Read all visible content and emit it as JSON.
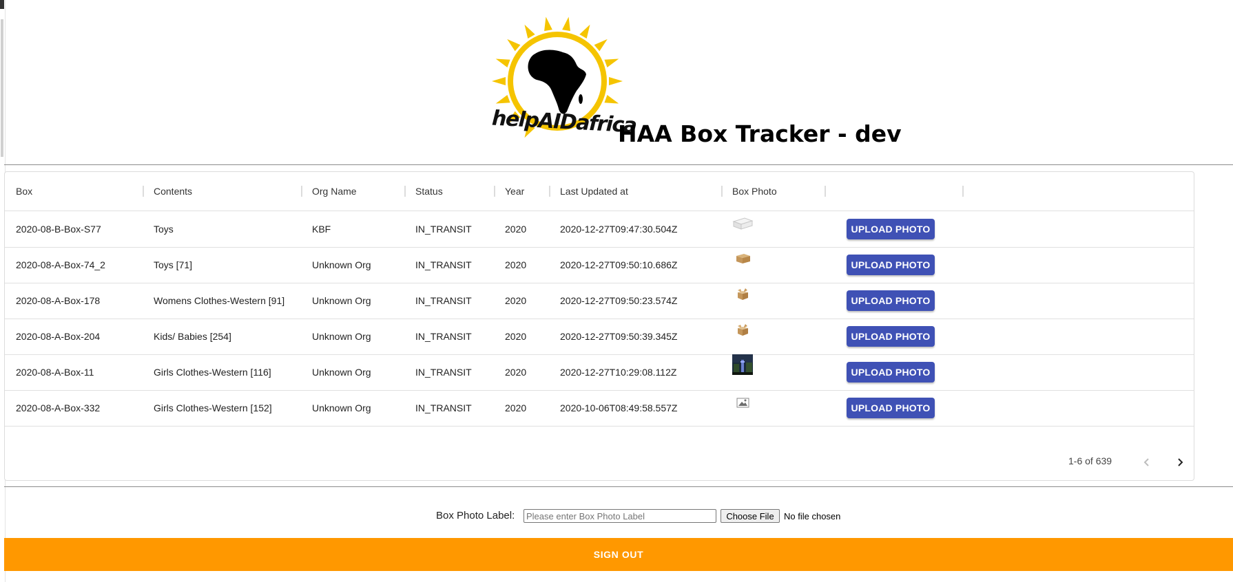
{
  "header": {
    "logo_text": "helpAIDafrica",
    "title": "HAA Box Tracker - dev"
  },
  "table": {
    "columns": [
      "Box",
      "Contents",
      "Org Name",
      "Status",
      "Year",
      "Last Updated at",
      "Box Photo",
      ""
    ],
    "rows": [
      {
        "box": "2020-08-B-Box-S77",
        "contents": "Toys",
        "org": "KBF",
        "status": "IN_TRANSIT",
        "year": "2020",
        "updated": "2020-12-27T09:47:30.504Z",
        "photo_icon": "white-box-photo",
        "action": "UPLOAD PHOTO"
      },
      {
        "box": "2020-08-A-Box-74_2",
        "contents": "Toys [71]",
        "org": "Unknown Org",
        "status": "IN_TRANSIT",
        "year": "2020",
        "updated": "2020-12-27T09:50:10.686Z",
        "photo_icon": "cardboard-box-photo",
        "action": "UPLOAD PHOTO"
      },
      {
        "box": "2020-08-A-Box-178",
        "contents": "Womens Clothes-Western [91]",
        "org": "Unknown Org",
        "status": "IN_TRANSIT",
        "year": "2020",
        "updated": "2020-12-27T09:50:23.574Z",
        "photo_icon": "open-box-photo",
        "action": "UPLOAD PHOTO"
      },
      {
        "box": "2020-08-A-Box-204",
        "contents": "Kids/ Babies [254]",
        "org": "Unknown Org",
        "status": "IN_TRANSIT",
        "year": "2020",
        "updated": "2020-12-27T09:50:39.345Z",
        "photo_icon": "open-box-photo",
        "action": "UPLOAD PHOTO"
      },
      {
        "box": "2020-08-A-Box-11",
        "contents": "Girls Clothes-Western [116]",
        "org": "Unknown Org",
        "status": "IN_TRANSIT",
        "year": "2020",
        "updated": "2020-12-27T10:29:08.112Z",
        "photo_icon": "dark-scene-photo",
        "action": "UPLOAD PHOTO"
      },
      {
        "box": "2020-08-A-Box-332",
        "contents": "Girls Clothes-Western [152]",
        "org": "Unknown Org",
        "status": "IN_TRANSIT",
        "year": "2020",
        "updated": "2020-10-06T08:49:58.557Z",
        "photo_icon": "broken-image-icon",
        "action": "UPLOAD PHOTO"
      }
    ]
  },
  "pagination": {
    "range_text": "1-6 of 639"
  },
  "photo_form": {
    "label": "Box Photo Label:",
    "placeholder": "Please enter Box Photo Label",
    "choose_file_label": "Choose File",
    "file_status": "No file chosen"
  },
  "footer": {
    "sign_out_label": "SIGN OUT"
  },
  "colors": {
    "primary_button": "#3f51b5",
    "sign_out": "#ff9800",
    "logo_sun": "#f5c400"
  }
}
